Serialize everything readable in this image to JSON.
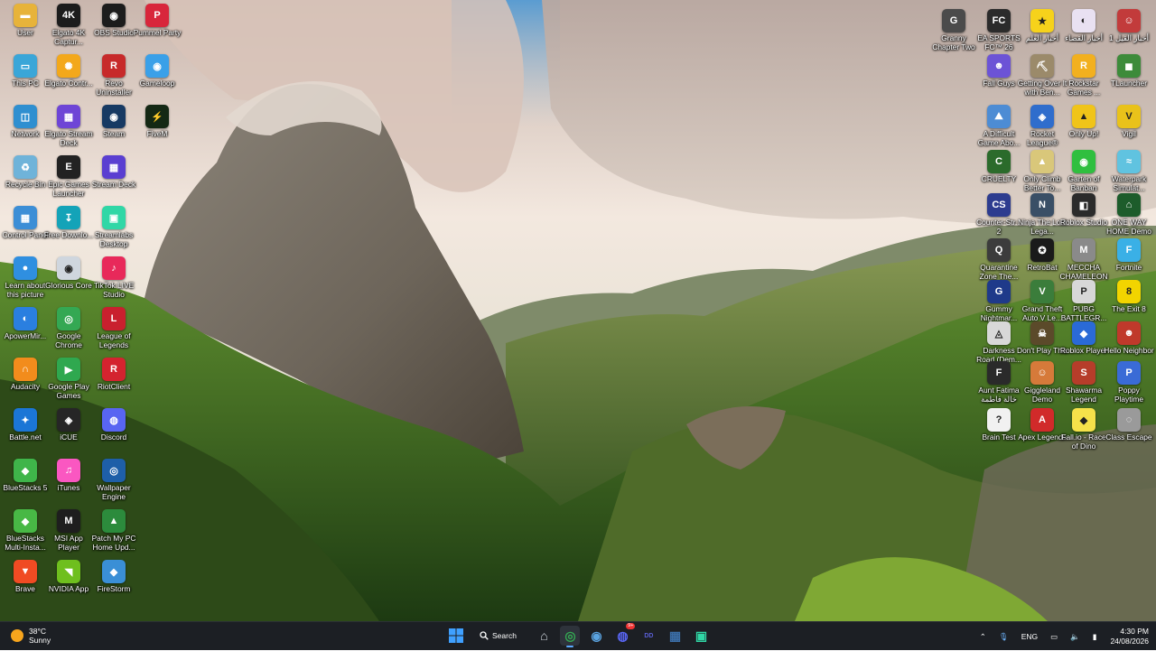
{
  "desktop_left": [
    {
      "label": "User",
      "color": "#e7b33a",
      "glyph": "▬"
    },
    {
      "label": "This PC",
      "color": "#3aa6d8",
      "glyph": "▭"
    },
    {
      "label": "Network",
      "color": "#2f8fd0",
      "glyph": "◫"
    },
    {
      "label": "Recycle Bin",
      "color": "#6fb3d9",
      "glyph": "♻"
    },
    {
      "label": "Control Panel",
      "color": "#3c8ed6",
      "glyph": "▦"
    },
    {
      "label": "Learn about this picture",
      "color": "#2f8fe0",
      "glyph": "●"
    },
    {
      "label": "ApowerMir...",
      "color": "#2a7fe0",
      "glyph": "◐"
    },
    {
      "label": "Audacity",
      "color": "#f28c1c",
      "glyph": "∩"
    },
    {
      "label": "Battle.net",
      "color": "#1b76d6",
      "glyph": "✦"
    },
    {
      "label": "BlueStacks 5",
      "color": "#3fb54a",
      "glyph": "◆"
    },
    {
      "label": "BlueStacks Multi-Insta...",
      "color": "#48b845",
      "glyph": "◆"
    },
    {
      "label": "Brave",
      "color": "#f04b23",
      "glyph": "▼"
    },
    {
      "label": "Elgato 4K Captur...",
      "color": "#1c1c1c",
      "glyph": "4K"
    },
    {
      "label": "Elgato Contr...",
      "color": "#f3a81b",
      "glyph": "✺"
    },
    {
      "label": "Elgato Stream Deck",
      "color": "#6e45d6",
      "glyph": "▦"
    },
    {
      "label": "Epic Games Launcher",
      "color": "#222222",
      "glyph": "E"
    },
    {
      "label": "Free Downlo...",
      "color": "#14a3b8",
      "glyph": "↧"
    },
    {
      "label": "Glorious Core",
      "color": "#cfd6de",
      "glyph": "◉"
    },
    {
      "label": "Google Chrome",
      "color": "#34a853",
      "glyph": "◎"
    },
    {
      "label": "Google Play Games",
      "color": "#2fa84f",
      "glyph": "▶"
    },
    {
      "label": "iCUE",
      "color": "#262626",
      "glyph": "◈"
    },
    {
      "label": "iTunes",
      "color": "#fa57c1",
      "glyph": "♫"
    },
    {
      "label": "MSI App Player",
      "color": "#1e1e1e",
      "glyph": "M"
    },
    {
      "label": "NVIDIA App",
      "color": "#6fbf1e",
      "glyph": "◥"
    },
    {
      "label": "OBS Studio",
      "color": "#1c1c1c",
      "glyph": "◉"
    },
    {
      "label": "Revo Uninstaller",
      "color": "#c72a2a",
      "glyph": "R"
    },
    {
      "label": "Steam",
      "color": "#173a63",
      "glyph": "◉"
    },
    {
      "label": "Stream Deck",
      "color": "#5a3fd1",
      "glyph": "▦"
    },
    {
      "label": "Streamlabs Desktop",
      "color": "#30d7a6",
      "glyph": "▣"
    },
    {
      "label": "TikTok LIVE Studio",
      "color": "#e8295a",
      "glyph": "♪"
    },
    {
      "label": "League of Legends",
      "color": "#c9202e",
      "glyph": "L"
    },
    {
      "label": "RiotClient",
      "color": "#d4232f",
      "glyph": "R"
    },
    {
      "label": "Discord",
      "color": "#5865f2",
      "glyph": "◍"
    },
    {
      "label": "Wallpaper Engine",
      "color": "#1e5fa8",
      "glyph": "◎"
    },
    {
      "label": "Patch My PC Home Upd...",
      "color": "#2c8b3c",
      "glyph": "▲"
    },
    {
      "label": "FireStorm",
      "color": "#3a8fd6",
      "glyph": "◆"
    },
    {
      "label": "Pummel Party",
      "color": "#d8263b",
      "glyph": "P"
    },
    {
      "label": "Gameloop",
      "color": "#3aa0e8",
      "glyph": "◉"
    },
    {
      "label": "FiveM",
      "color": "#142814",
      "glyph": "⚡"
    }
  ],
  "desktop_right": [
    {
      "label": "Granny Chapter Two",
      "color": "#4b4b4b",
      "glyph": "G"
    },
    {
      "label": "EA SPORTS FC™ 26",
      "color": "#2b2b2b",
      "glyph": "FC"
    },
    {
      "label": "أخبار العلم",
      "color": "#f6d21b",
      "glyph": "★"
    },
    {
      "label": "أخبار القضاء",
      "color": "#e9e1f2",
      "glyph": "◐"
    },
    {
      "label": "أخبار القيل 1",
      "color": "#c23b3b",
      "glyph": "☺"
    },
    {
      "label": "Fall Guys",
      "color": "#6c53d6",
      "glyph": "☻"
    },
    {
      "label": "Getting Over It with Ben...",
      "color": "#9b8a6a",
      "glyph": "⛏"
    },
    {
      "label": "Rockstar Games ...",
      "color": "#f2b01f",
      "glyph": "R"
    },
    {
      "label": "TLauncher",
      "color": "#3d8b3a",
      "glyph": "◼"
    },
    {
      "label": "A Difficult Game Abo...",
      "color": "#4d8cd4",
      "glyph": "⛰"
    },
    {
      "label": "Rocket League®",
      "color": "#2f6dcc",
      "glyph": "◈"
    },
    {
      "label": "Only Up!",
      "color": "#f0c419",
      "glyph": "▲"
    },
    {
      "label": "Vigil",
      "color": "#e9c21a",
      "glyph": "V"
    },
    {
      "label": "CRUELTY",
      "color": "#2b6b2b",
      "glyph": "C"
    },
    {
      "label": "Only Climb Better To...",
      "color": "#d9c77a",
      "glyph": "▲"
    },
    {
      "label": "Garten of Banban",
      "color": "#2fbf3f",
      "glyph": "◉"
    },
    {
      "label": "Waterpark Simulat...",
      "color": "#60c3e0",
      "glyph": "≈"
    },
    {
      "label": "Counter-Str... 2",
      "color": "#2d3c8f",
      "glyph": "CS"
    },
    {
      "label": "Ninja The Lost Lega...",
      "color": "#3a4f66",
      "glyph": "N"
    },
    {
      "label": "Roblox Studio",
      "color": "#2b2b2b",
      "glyph": "◧"
    },
    {
      "label": "ONE WAY HOME Demo",
      "color": "#1d5c2b",
      "glyph": "⌂"
    },
    {
      "label": "Quarantine Zone The...",
      "color": "#3c3c3c",
      "glyph": "Q"
    },
    {
      "label": "RetroBat",
      "color": "#1a1a1a",
      "glyph": "✪"
    },
    {
      "label": "MECCHA CHAMELEON",
      "color": "#8a8a8a",
      "glyph": "M"
    },
    {
      "label": "Fortnite",
      "color": "#3ab0e6",
      "glyph": "F"
    },
    {
      "label": "Gummy Nightmar...",
      "color": "#1f3a8a",
      "glyph": "G"
    },
    {
      "label": "Grand Theft Auto V Le...",
      "color": "#3b7d3b",
      "glyph": "V"
    },
    {
      "label": "PUBG BATTLEGR...",
      "color": "#d7d7d7",
      "glyph": "P"
    },
    {
      "label": "The Exit 8",
      "color": "#f2d400",
      "glyph": "8"
    },
    {
      "label": "Darkness Road (Dem...",
      "color": "#d8d8d8",
      "glyph": "◬"
    },
    {
      "label": "Don't Play This",
      "color": "#5b4a2a",
      "glyph": "☠"
    },
    {
      "label": "Roblox Player",
      "color": "#2a6ad6",
      "glyph": "◆"
    },
    {
      "label": "Hello Neighbor",
      "color": "#c0392b",
      "glyph": "☻"
    },
    {
      "label": "Aunt Fatima خالة فاطمة",
      "color": "#2a2a2a",
      "glyph": "F"
    },
    {
      "label": "Giggleland Demo",
      "color": "#d67a3a",
      "glyph": "☺"
    },
    {
      "label": "Shawarma Legend",
      "color": "#b63d2a",
      "glyph": "S"
    },
    {
      "label": "Poppy Playtime",
      "color": "#3a6bd6",
      "glyph": "P"
    },
    {
      "label": "Brain Test",
      "color": "#f1f1f1",
      "glyph": "?"
    },
    {
      "label": "Apex Legends",
      "color": "#d12a2a",
      "glyph": "A"
    },
    {
      "label": "Fall.io - Race of Dino",
      "color": "#f5e14a",
      "glyph": "◆"
    },
    {
      "label": "Class Escape",
      "color": "#9a9a9a",
      "glyph": "◌"
    }
  ],
  "taskbar": {
    "weather_temp": "38°C",
    "weather_cond": "Sunny",
    "search_label": "Search",
    "pinned": [
      {
        "name": "home",
        "color": "#cfd6dd",
        "glyph": "⌂"
      },
      {
        "name": "chrome",
        "color": "#34a853",
        "glyph": "◎"
      },
      {
        "name": "steam",
        "color": "#5aa3e0",
        "glyph": "◉"
      },
      {
        "name": "discord",
        "color": "#5865f2",
        "glyph": "◍"
      },
      {
        "name": "dd",
        "color": "#5a5fd6",
        "glyph": "DD"
      },
      {
        "name": "app",
        "color": "#3b6ea8",
        "glyph": "▦"
      },
      {
        "name": "streamlabs",
        "color": "#30d7a6",
        "glyph": "▣"
      }
    ],
    "discord_badge": "9+",
    "lang": "ENG",
    "time": "4:30 PM",
    "date": "24/08/2026"
  }
}
